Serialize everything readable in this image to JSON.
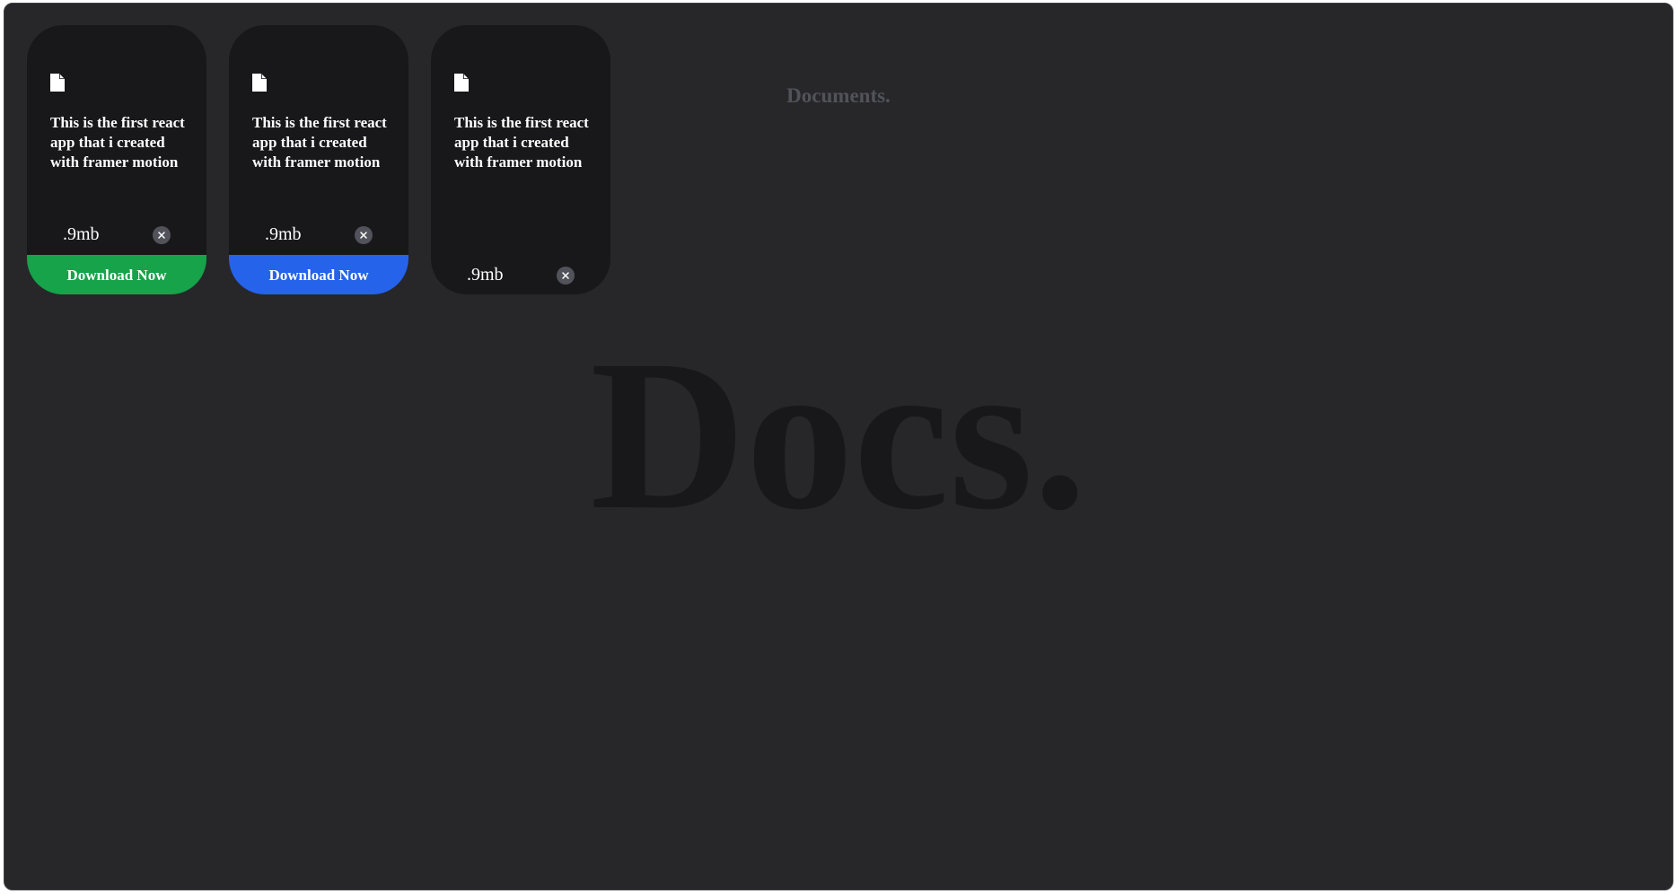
{
  "background": {
    "subtitle": "Documents.",
    "title": "Docs."
  },
  "cards": [
    {
      "icon": "file-icon",
      "description": "This is the first react app that i created with framer motion",
      "size": ".9mb",
      "close_icon": "close-icon",
      "download": {
        "label": "Download Now",
        "color": "#16a34a"
      }
    },
    {
      "icon": "file-icon",
      "description": "This is the first react app that i created with framer motion",
      "size": ".9mb",
      "close_icon": "close-icon",
      "download": {
        "label": "Download Now",
        "color": "#2563eb"
      }
    },
    {
      "icon": "file-icon",
      "description": "This is the first react app that i created with framer motion",
      "size": ".9mb",
      "close_icon": "close-icon",
      "download": null
    }
  ]
}
